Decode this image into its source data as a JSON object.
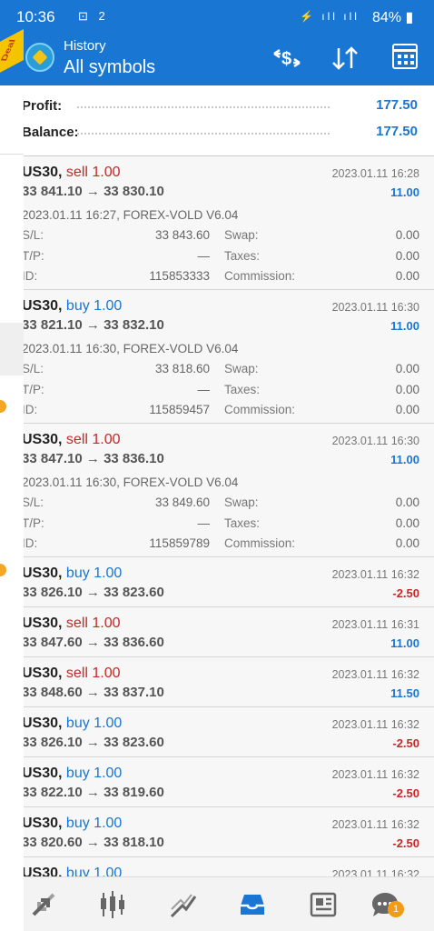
{
  "status_bar": {
    "time": "10:36",
    "extra": "⊡ 2",
    "battery": "84%"
  },
  "header": {
    "subtitle": "History",
    "title": "All symbols",
    "badge": "Deal"
  },
  "summary": {
    "profit_label": "Profit:",
    "profit_value": "177.50",
    "balance_label": "Balance:",
    "balance_value": "177.50"
  },
  "labels": {
    "sl": "S/L:",
    "tp": "T/P:",
    "id": "ID:",
    "swap": "Swap:",
    "taxes": "Taxes:",
    "commission": "Commission:"
  },
  "trades": [
    {
      "symbol": "US30,",
      "side": "sell",
      "volume": "1.00",
      "prices": "33 841.10 → 33 830.10",
      "time": "2023.01.11 16:28",
      "profit": "11.00",
      "comment": "2023.01.11 16:27, FOREX-VOLD V6.04",
      "sl": "33 843.60",
      "tp": "—",
      "id": "115853333",
      "swap": "0.00",
      "taxes": "0.00",
      "commission": "0.00"
    },
    {
      "symbol": "US30,",
      "side": "buy",
      "volume": "1.00",
      "prices": "33 821.10 → 33 832.10",
      "time": "2023.01.11 16:30",
      "profit": "11.00",
      "comment": "2023.01.11 16:30, FOREX-VOLD V6.04",
      "sl": "33 818.60",
      "tp": "—",
      "id": "115859457",
      "swap": "0.00",
      "taxes": "0.00",
      "commission": "0.00"
    },
    {
      "symbol": "US30,",
      "side": "sell",
      "volume": "1.00",
      "prices": "33 847.10 → 33 836.10",
      "time": "2023.01.11 16:30",
      "profit": "11.00",
      "comment": "2023.01.11 16:30, FOREX-VOLD V6.04",
      "sl": "33 849.60",
      "tp": "—",
      "id": "115859789",
      "swap": "0.00",
      "taxes": "0.00",
      "commission": "0.00"
    },
    {
      "symbol": "US30,",
      "side": "buy",
      "volume": "1.00",
      "prices": "33 826.10 → 33 823.60",
      "time": "2023.01.11 16:32",
      "profit": "-2.50"
    },
    {
      "symbol": "US30,",
      "side": "sell",
      "volume": "1.00",
      "prices": "33 847.60 → 33 836.60",
      "time": "2023.01.11 16:31",
      "profit": "11.00"
    },
    {
      "symbol": "US30,",
      "side": "sell",
      "volume": "1.00",
      "prices": "33 848.60 → 33 837.10",
      "time": "2023.01.11 16:32",
      "profit": "11.50"
    },
    {
      "symbol": "US30,",
      "side": "buy",
      "volume": "1.00",
      "prices": "33 826.10 → 33 823.60",
      "time": "2023.01.11 16:32",
      "profit": "-2.50"
    },
    {
      "symbol": "US30,",
      "side": "buy",
      "volume": "1.00",
      "prices": "33 822.10 → 33 819.60",
      "time": "2023.01.11 16:32",
      "profit": "-2.50"
    },
    {
      "symbol": "US30,",
      "side": "buy",
      "volume": "1.00",
      "prices": "33 820.60 → 33 818.10",
      "time": "2023.01.11 16:32",
      "profit": "-2.50"
    },
    {
      "symbol": "US30,",
      "side": "buy",
      "volume": "1.00",
      "prices": "",
      "time": "2023.01.11 16:32",
      "profit": ""
    }
  ],
  "nav": {
    "items": [
      {
        "name": "quotes",
        "icon": "quotes-arrows-icon"
      },
      {
        "name": "chart",
        "icon": "candlestick-icon"
      },
      {
        "name": "trade",
        "icon": "trade-trend-icon"
      },
      {
        "name": "history",
        "icon": "inbox-tray-icon"
      },
      {
        "name": "news",
        "icon": "newspaper-icon"
      },
      {
        "name": "messages",
        "icon": "chat-bubble-icon"
      }
    ],
    "messages_badge": "1"
  },
  "colors": {
    "accent": "#1976d2",
    "sell": "#c62828",
    "badge": "#f39c12"
  }
}
